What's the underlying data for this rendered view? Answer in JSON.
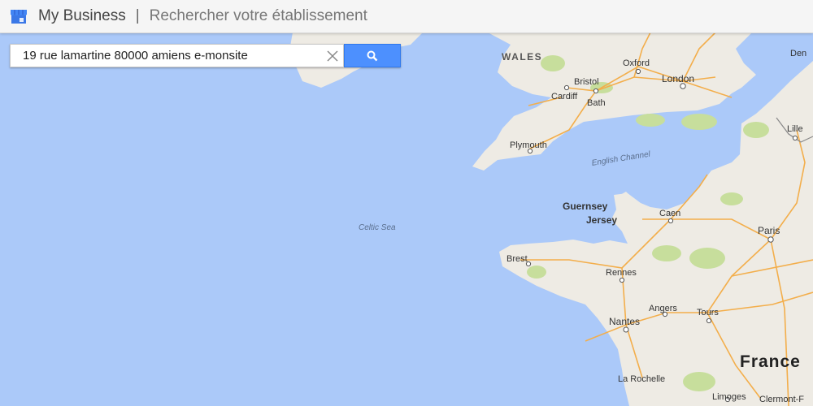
{
  "header": {
    "brand": "My Business",
    "separator": "|",
    "subtitle": "Rechercher votre établissement",
    "logo_icon": "store-icon"
  },
  "search": {
    "value": "19 rue lamartine 80000 amiens e-monsite",
    "clear_icon": "close-icon",
    "button_icon": "search-icon",
    "button_color": "#4d90fe"
  },
  "map": {
    "colors": {
      "sea": "#abc9f9",
      "land": "#eeebe4",
      "roads": "#f3ae4b",
      "parks": "#c7de9c"
    },
    "labels": {
      "wales": "WALES",
      "den": "Den",
      "oxford": "Oxford",
      "london": "London",
      "bristol": "Bristol",
      "cardiff": "Cardiff",
      "bath": "Bath",
      "lille": "Lille",
      "plymouth": "Plymouth",
      "english_channel": "English Channel",
      "guernsey": "Guernsey",
      "jersey": "Jersey",
      "caen": "Caen",
      "paris": "Paris",
      "celtic_sea": "Celtic Sea",
      "brest": "Brest",
      "rennes": "Rennes",
      "angers": "Angers",
      "tours": "Tours",
      "nantes": "Nantes",
      "france": "France",
      "la_rochelle": "La Rochelle",
      "limoges": "Limoges",
      "clermont": "Clermont-F"
    }
  }
}
